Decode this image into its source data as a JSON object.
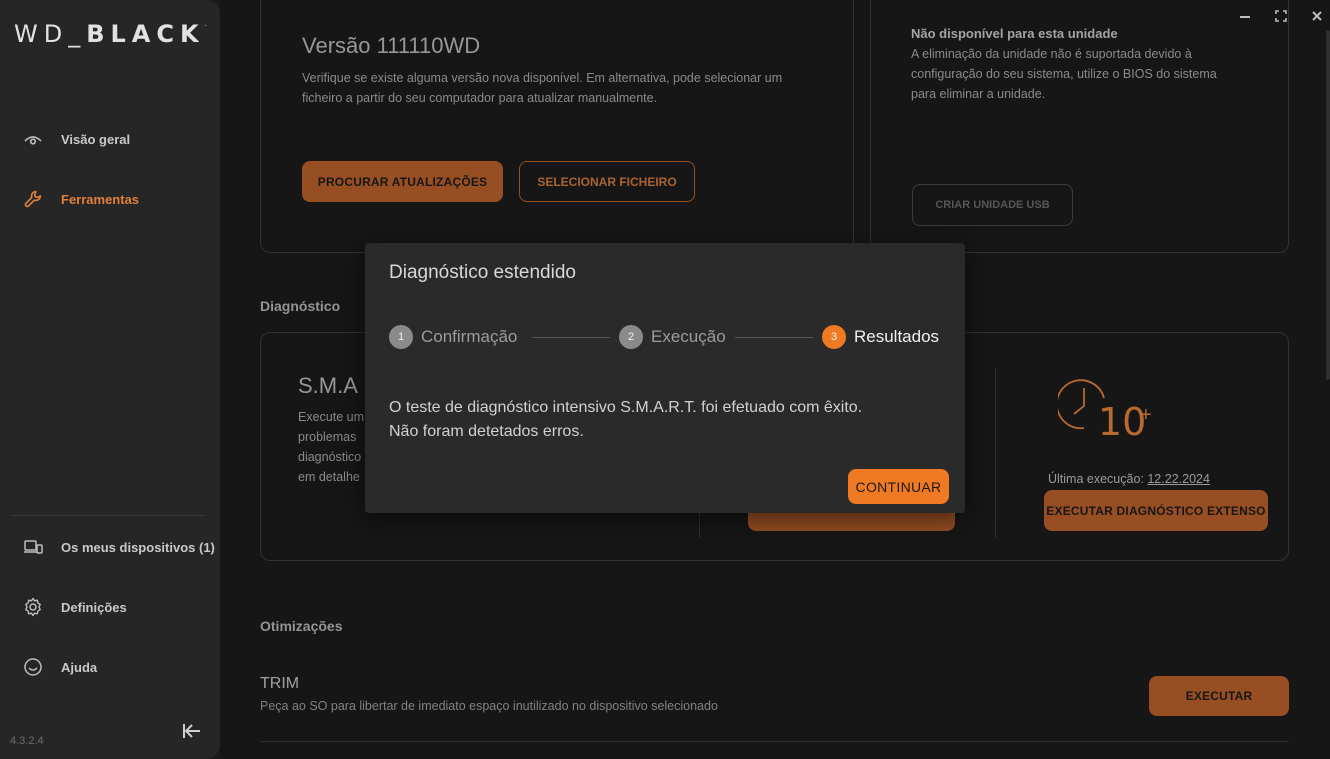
{
  "app": {
    "logo_left": "WD_",
    "logo_right": "BLACK",
    "logo_mark": ".",
    "version": "4.3.2.4"
  },
  "sidebar": {
    "items": [
      {
        "label": "Visão geral",
        "icon": "eye-icon"
      },
      {
        "label": "Ferramentas",
        "icon": "wrench-icon",
        "active": true
      },
      {
        "label": "Os meus dispositivos (1)",
        "icon": "devices-icon"
      },
      {
        "label": "Definições",
        "icon": "gear-icon"
      },
      {
        "label": "Ajuda",
        "icon": "help-icon"
      }
    ]
  },
  "firmware": {
    "title": "Versão 111110WD",
    "description_line1": "Verifique se existe alguma versão nova disponível. Em alternativa, pode selecionar um",
    "description_line2": "ficheiro a partir do seu computador para atualizar manualmente.",
    "check_button": "PROCURAR ATUALIZAÇÕES",
    "select_button": "SELECIONAR FICHEIRO"
  },
  "erase": {
    "title": "Não disponível para esta unidade",
    "line1": "A eliminação da unidade não é suportada devido à",
    "line2": "configuração do seu sistema, utilize o BIOS do sistema",
    "line3": "para eliminar a unidade.",
    "usb_button": "CRIAR UNIDADE USB"
  },
  "diagnostics": {
    "section_label": "Diagnóstico",
    "smart_title": "S.M.A",
    "lines": [
      "Execute um",
      "problemas",
      "diagnóstico",
      "em detalhe"
    ],
    "extended": {
      "badge_text": "10",
      "badge_plus": "+",
      "last_run_label": "Última execução:",
      "last_run_date": "12.22.2024",
      "button": "EXECUTAR DIAGNÓSTICO EXTENSO"
    }
  },
  "optimizations": {
    "section_label": "Otimizações",
    "trim_title": "TRIM",
    "trim_desc": "Peça ao SO para libertar de imediato espaço inutilizado no dispositivo selecionado",
    "run_button": "EXECUTAR"
  },
  "modal": {
    "title": "Diagnóstico estendido",
    "steps": [
      {
        "num": "1",
        "label": "Confirmação"
      },
      {
        "num": "2",
        "label": "Execução"
      },
      {
        "num": "3",
        "label": "Resultados",
        "active": true
      }
    ],
    "message_line1": "O teste de diagnóstico intensivo S.M.A.R.T. foi efetuado com êxito.",
    "message_line2": "Não foram detetados erros.",
    "continue_button": "CONTINUAR"
  },
  "colors": {
    "accent": "#f07a24",
    "accent_dim": "#b9602a",
    "sidebar_bg": "#262626",
    "page_bg": "#1b1b1b"
  }
}
